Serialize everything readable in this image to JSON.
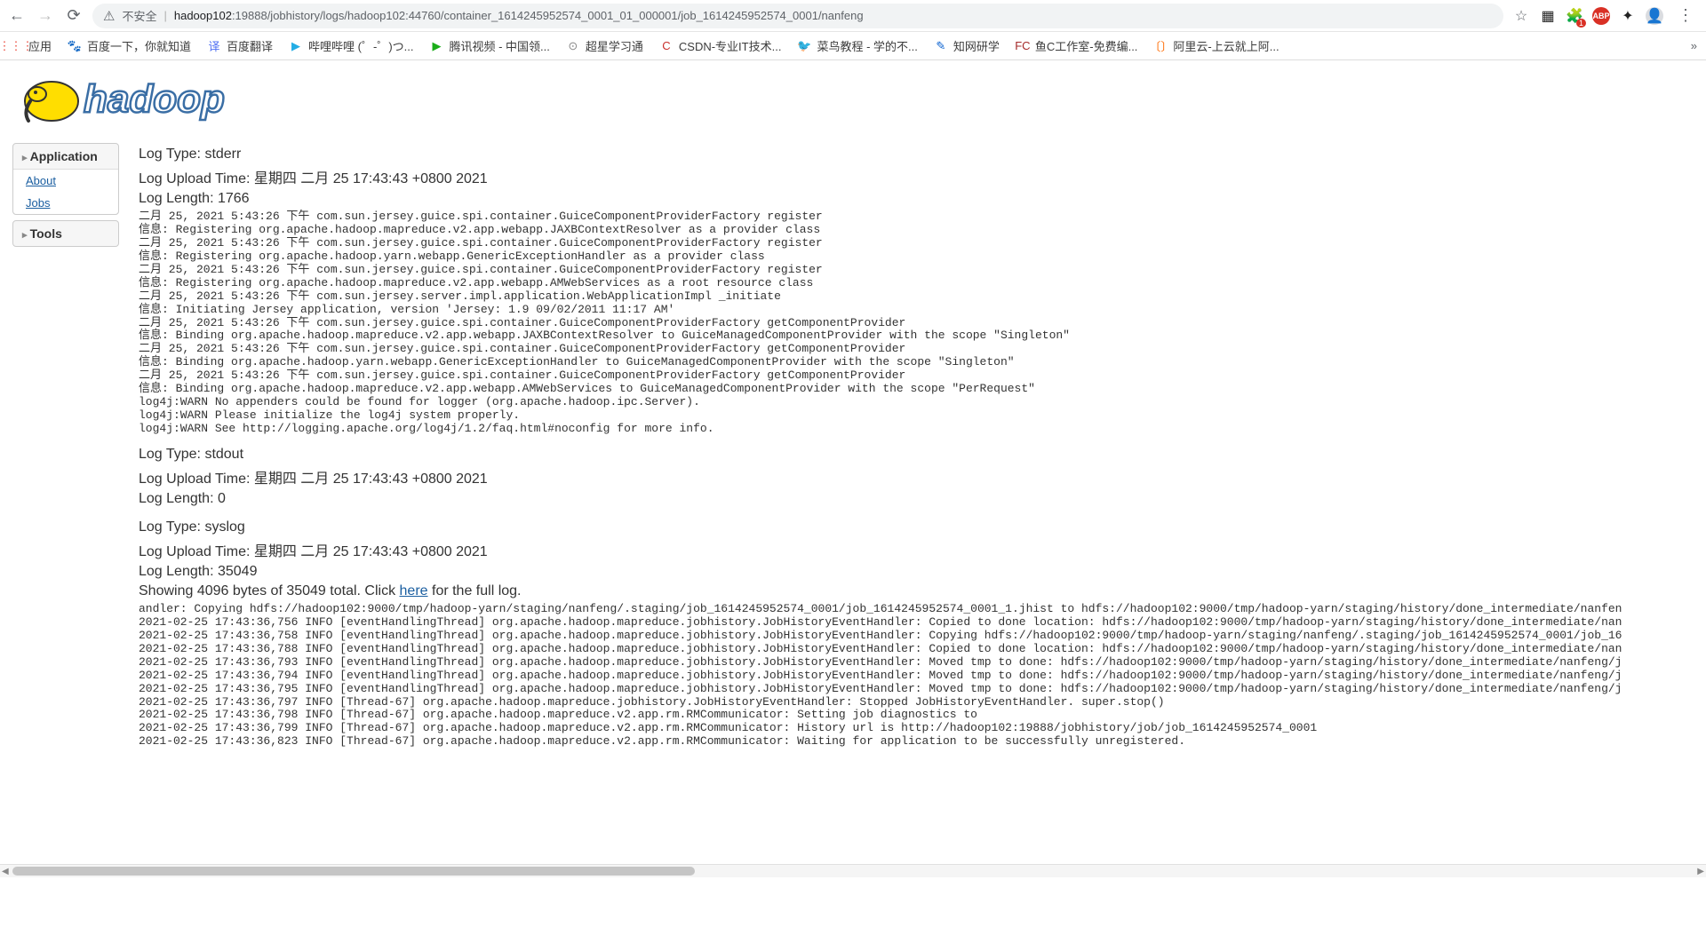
{
  "browser": {
    "security_label": "不安全",
    "url_host": "hadoop102",
    "url_rest": ":19888/jobhistory/logs/hadoop102:44760/container_1614245952574_0001_01_000001/job_1614245952574_0001/nanfeng",
    "bookmarks_label": "应用",
    "bookmarks": [
      {
        "icon": "🐾",
        "color": "#4e6ef2",
        "label": "百度一下，你就知道"
      },
      {
        "icon": "译",
        "color": "#4e6ef2",
        "label": "百度翻译"
      },
      {
        "icon": "▶",
        "color": "#23ade5",
        "label": "哔哩哔哩 (゜-゜)つ..."
      },
      {
        "icon": "▶",
        "color": "#1aad19",
        "label": "腾讯视频 - 中国领..."
      },
      {
        "icon": "⊙",
        "color": "#888",
        "label": "超星学习通"
      },
      {
        "icon": "C",
        "color": "#c9302c",
        "label": "CSDN-专业IT技术..."
      },
      {
        "icon": "🐦",
        "color": "#8bc34a",
        "label": "菜鸟教程 - 学的不..."
      },
      {
        "icon": "✎",
        "color": "#0b62d0",
        "label": "知网研学"
      },
      {
        "icon": "FC",
        "color": "#a52a2a",
        "label": "鱼C工作室-免费编..."
      },
      {
        "icon": "〔〕",
        "color": "#ff6a00",
        "label": "阿里云-上云就上阿..."
      }
    ]
  },
  "sidebar": {
    "app_label": "Application",
    "links": [
      "About",
      "Jobs"
    ],
    "tools_label": "Tools"
  },
  "logo_text": "hadoop",
  "sections": {
    "stderr": {
      "type_label": "Log Type: ",
      "type_value": "stderr",
      "upload_label": "Log Upload Time: ",
      "upload_value": "星期四 二月 25 17:43:43 +0800 2021",
      "length_label": "Log Length: ",
      "length_value": "1766",
      "body": "二月 25, 2021 5:43:26 下午 com.sun.jersey.guice.spi.container.GuiceComponentProviderFactory register\n信息: Registering org.apache.hadoop.mapreduce.v2.app.webapp.JAXBContextResolver as a provider class\n二月 25, 2021 5:43:26 下午 com.sun.jersey.guice.spi.container.GuiceComponentProviderFactory register\n信息: Registering org.apache.hadoop.yarn.webapp.GenericExceptionHandler as a provider class\n二月 25, 2021 5:43:26 下午 com.sun.jersey.guice.spi.container.GuiceComponentProviderFactory register\n信息: Registering org.apache.hadoop.mapreduce.v2.app.webapp.AMWebServices as a root resource class\n二月 25, 2021 5:43:26 下午 com.sun.jersey.server.impl.application.WebApplicationImpl _initiate\n信息: Initiating Jersey application, version 'Jersey: 1.9 09/02/2011 11:17 AM'\n二月 25, 2021 5:43:26 下午 com.sun.jersey.guice.spi.container.GuiceComponentProviderFactory getComponentProvider\n信息: Binding org.apache.hadoop.mapreduce.v2.app.webapp.JAXBContextResolver to GuiceManagedComponentProvider with the scope \"Singleton\"\n二月 25, 2021 5:43:26 下午 com.sun.jersey.guice.spi.container.GuiceComponentProviderFactory getComponentProvider\n信息: Binding org.apache.hadoop.yarn.webapp.GenericExceptionHandler to GuiceManagedComponentProvider with the scope \"Singleton\"\n二月 25, 2021 5:43:26 下午 com.sun.jersey.guice.spi.container.GuiceComponentProviderFactory getComponentProvider\n信息: Binding org.apache.hadoop.mapreduce.v2.app.webapp.AMWebServices to GuiceManagedComponentProvider with the scope \"PerRequest\"\nlog4j:WARN No appenders could be found for logger (org.apache.hadoop.ipc.Server).\nlog4j:WARN Please initialize the log4j system properly.\nlog4j:WARN See http://logging.apache.org/log4j/1.2/faq.html#noconfig for more info."
    },
    "stdout": {
      "type_label": "Log Type: ",
      "type_value": "stdout",
      "upload_label": "Log Upload Time: ",
      "upload_value": "星期四 二月 25 17:43:43 +0800 2021",
      "length_label": "Log Length: ",
      "length_value": "0"
    },
    "syslog": {
      "type_label": "Log Type: ",
      "type_value": "syslog",
      "upload_label": "Log Upload Time: ",
      "upload_value": "星期四 二月 25 17:43:43 +0800 2021",
      "length_label": "Log Length: ",
      "length_value": "35049",
      "summary_pre": "Showing 4096 bytes of 35049 total. Click ",
      "summary_link": "here",
      "summary_post": " for the full log.",
      "body": "andler: Copying hdfs://hadoop102:9000/tmp/hadoop-yarn/staging/nanfeng/.staging/job_1614245952574_0001/job_1614245952574_0001_1.jhist to hdfs://hadoop102:9000/tmp/hadoop-yarn/staging/history/done_intermediate/nanfen\n2021-02-25 17:43:36,756 INFO [eventHandlingThread] org.apache.hadoop.mapreduce.jobhistory.JobHistoryEventHandler: Copied to done location: hdfs://hadoop102:9000/tmp/hadoop-yarn/staging/history/done_intermediate/nan\n2021-02-25 17:43:36,758 INFO [eventHandlingThread] org.apache.hadoop.mapreduce.jobhistory.JobHistoryEventHandler: Copying hdfs://hadoop102:9000/tmp/hadoop-yarn/staging/nanfeng/.staging/job_1614245952574_0001/job_16\n2021-02-25 17:43:36,788 INFO [eventHandlingThread] org.apache.hadoop.mapreduce.jobhistory.JobHistoryEventHandler: Copied to done location: hdfs://hadoop102:9000/tmp/hadoop-yarn/staging/history/done_intermediate/nan\n2021-02-25 17:43:36,793 INFO [eventHandlingThread] org.apache.hadoop.mapreduce.jobhistory.JobHistoryEventHandler: Moved tmp to done: hdfs://hadoop102:9000/tmp/hadoop-yarn/staging/history/done_intermediate/nanfeng/j\n2021-02-25 17:43:36,794 INFO [eventHandlingThread] org.apache.hadoop.mapreduce.jobhistory.JobHistoryEventHandler: Moved tmp to done: hdfs://hadoop102:9000/tmp/hadoop-yarn/staging/history/done_intermediate/nanfeng/j\n2021-02-25 17:43:36,795 INFO [eventHandlingThread] org.apache.hadoop.mapreduce.jobhistory.JobHistoryEventHandler: Moved tmp to done: hdfs://hadoop102:9000/tmp/hadoop-yarn/staging/history/done_intermediate/nanfeng/j\n2021-02-25 17:43:36,797 INFO [Thread-67] org.apache.hadoop.mapreduce.jobhistory.JobHistoryEventHandler: Stopped JobHistoryEventHandler. super.stop()\n2021-02-25 17:43:36,798 INFO [Thread-67] org.apache.hadoop.mapreduce.v2.app.rm.RMCommunicator: Setting job diagnostics to\n2021-02-25 17:43:36,799 INFO [Thread-67] org.apache.hadoop.mapreduce.v2.app.rm.RMCommunicator: History url is http://hadoop102:19888/jobhistory/job/job_1614245952574_0001\n2021-02-25 17:43:36,823 INFO [Thread-67] org.apache.hadoop.mapreduce.v2.app.rm.RMCommunicator: Waiting for application to be successfully unregistered."
    }
  }
}
